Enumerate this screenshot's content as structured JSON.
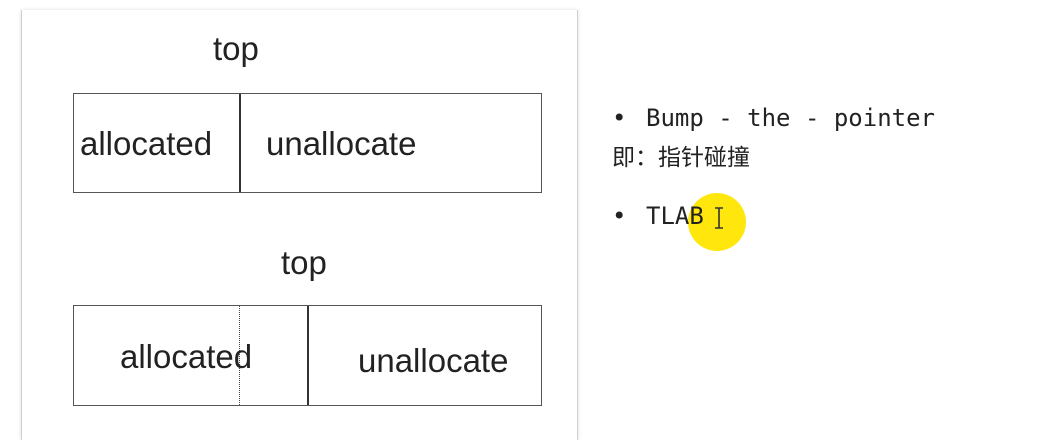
{
  "diagram": {
    "top_label_1": "top",
    "box1_allocated": "allocated",
    "box1_unallocated": "unallocate",
    "top_label_2": "top",
    "box2_allocated": "allocated",
    "box2_unallocated": "unallocate"
  },
  "bullets": {
    "item1_text": "Bump - the - pointer",
    "item1_sub": "即：指针碰撞",
    "item2_text": "TLAB"
  },
  "colors": {
    "highlight": "#ffe600",
    "text": "#222222"
  }
}
